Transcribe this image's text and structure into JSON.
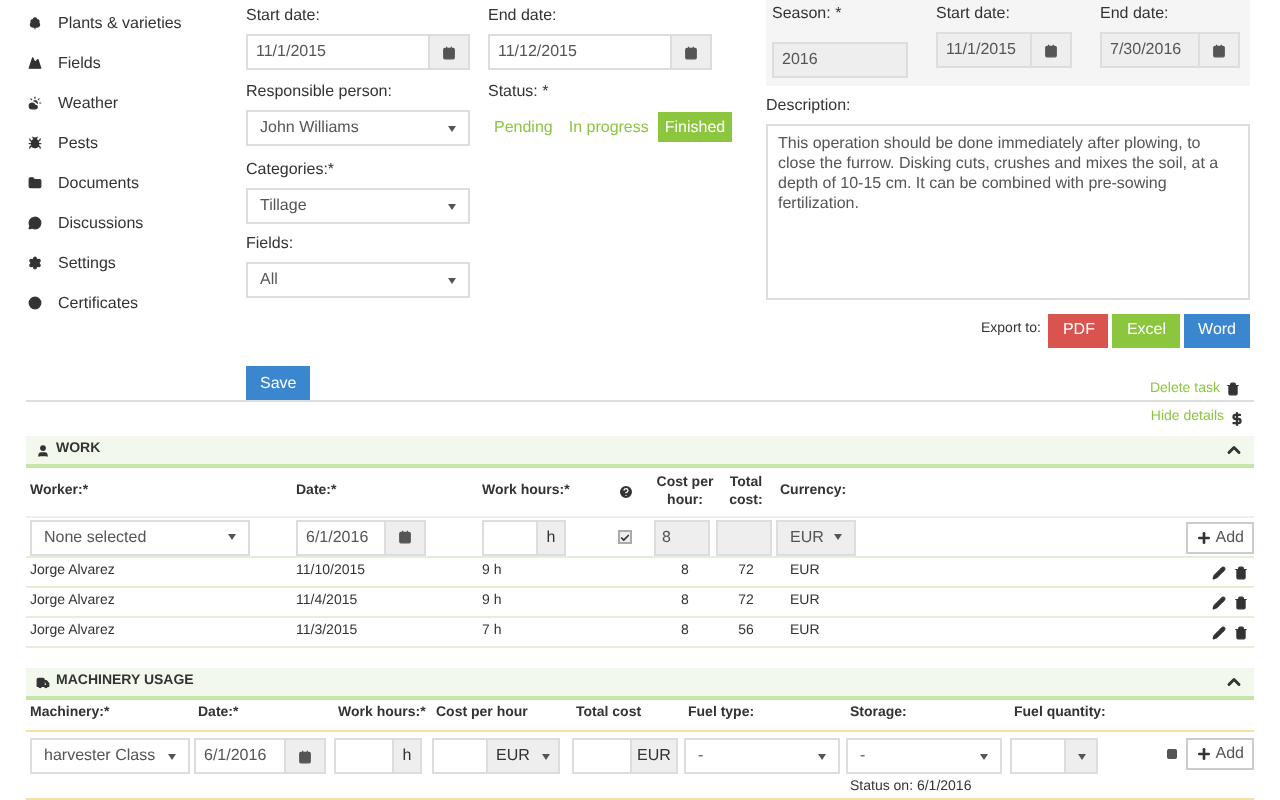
{
  "sidebar": {
    "items": [
      {
        "label": "Plants & varieties"
      },
      {
        "label": "Fields"
      },
      {
        "label": "Weather"
      },
      {
        "label": "Pests"
      },
      {
        "label": "Documents"
      },
      {
        "label": "Discussions"
      },
      {
        "label": "Settings"
      },
      {
        "label": "Certificates"
      }
    ]
  },
  "task": {
    "start_date": {
      "label": "Start date:",
      "value": "11/1/2015"
    },
    "end_date": {
      "label": "End date:",
      "value": "11/12/2015"
    },
    "responsible_person": {
      "label": "Responsible person:",
      "value": "John Williams"
    },
    "status": {
      "label": "Status: *",
      "options": [
        {
          "label": "Pending",
          "selected": false
        },
        {
          "label": "In progress",
          "selected": false
        },
        {
          "label": "Finished",
          "selected": true
        }
      ]
    },
    "categories": {
      "label": "Categories:*",
      "value": "Tillage"
    },
    "fields": {
      "label": "Fields:",
      "value": "All"
    },
    "save_button": "Save"
  },
  "season": {
    "season": {
      "label": "Season: *",
      "value": "2016"
    },
    "start_date": {
      "label": "Start date:",
      "value": "11/1/2015"
    },
    "end_date": {
      "label": "End date:",
      "value": "7/30/2016"
    }
  },
  "description": {
    "label": "Description:",
    "value": "This operation should be done immediately after plowing, to close the furrow. Disking cuts, crushes and mixes the soil, at a depth of 10-15 cm. It can be combined with pre-sowing fertilization."
  },
  "export": {
    "label": "Export to:",
    "buttons": [
      {
        "label": "PDF",
        "color": "#d9534f"
      },
      {
        "label": "Excel",
        "color": "#8cc63f"
      },
      {
        "label": "Word",
        "color": "#3a87d0"
      }
    ]
  },
  "delete_task": "Delete task",
  "hide_details": "Hide details",
  "work": {
    "title": "WORK",
    "columns": [
      "Worker:*",
      "Date:*",
      "Work hours:*",
      "Cost per hour:",
      "Total cost:",
      "Currency:"
    ],
    "form": {
      "worker": "None selected",
      "date": "6/1/2016",
      "hours_unit": "h",
      "checked": true,
      "cost": "8",
      "currency": "EUR",
      "add": "Add"
    },
    "rows": [
      {
        "worker": "Jorge Alvarez",
        "date": "11/10/2015",
        "hours": "9 h",
        "cost": "8",
        "total": "72",
        "currency": "EUR"
      },
      {
        "worker": "Jorge Alvarez",
        "date": "11/4/2015",
        "hours": "9 h",
        "cost": "8",
        "total": "72",
        "currency": "EUR"
      },
      {
        "worker": "Jorge Alvarez",
        "date": "11/3/2015",
        "hours": "7 h",
        "cost": "8",
        "total": "56",
        "currency": "EUR"
      }
    ]
  },
  "machinery": {
    "title": "MACHINERY USAGE",
    "columns": [
      "Machinery:*",
      "Date:*",
      "Work hours:*",
      "Cost per hour",
      "Total cost",
      "Fuel type:",
      "Storage:",
      "Fuel quantity:"
    ],
    "form": {
      "machinery": "harvester Class",
      "date": "6/1/2016",
      "hours_unit": "h",
      "cost_currency": "EUR",
      "total_unit": "EUR",
      "fuel_type": "-",
      "storage": "-",
      "storage_status": "Status on: 6/1/2016",
      "add": "Add"
    }
  }
}
